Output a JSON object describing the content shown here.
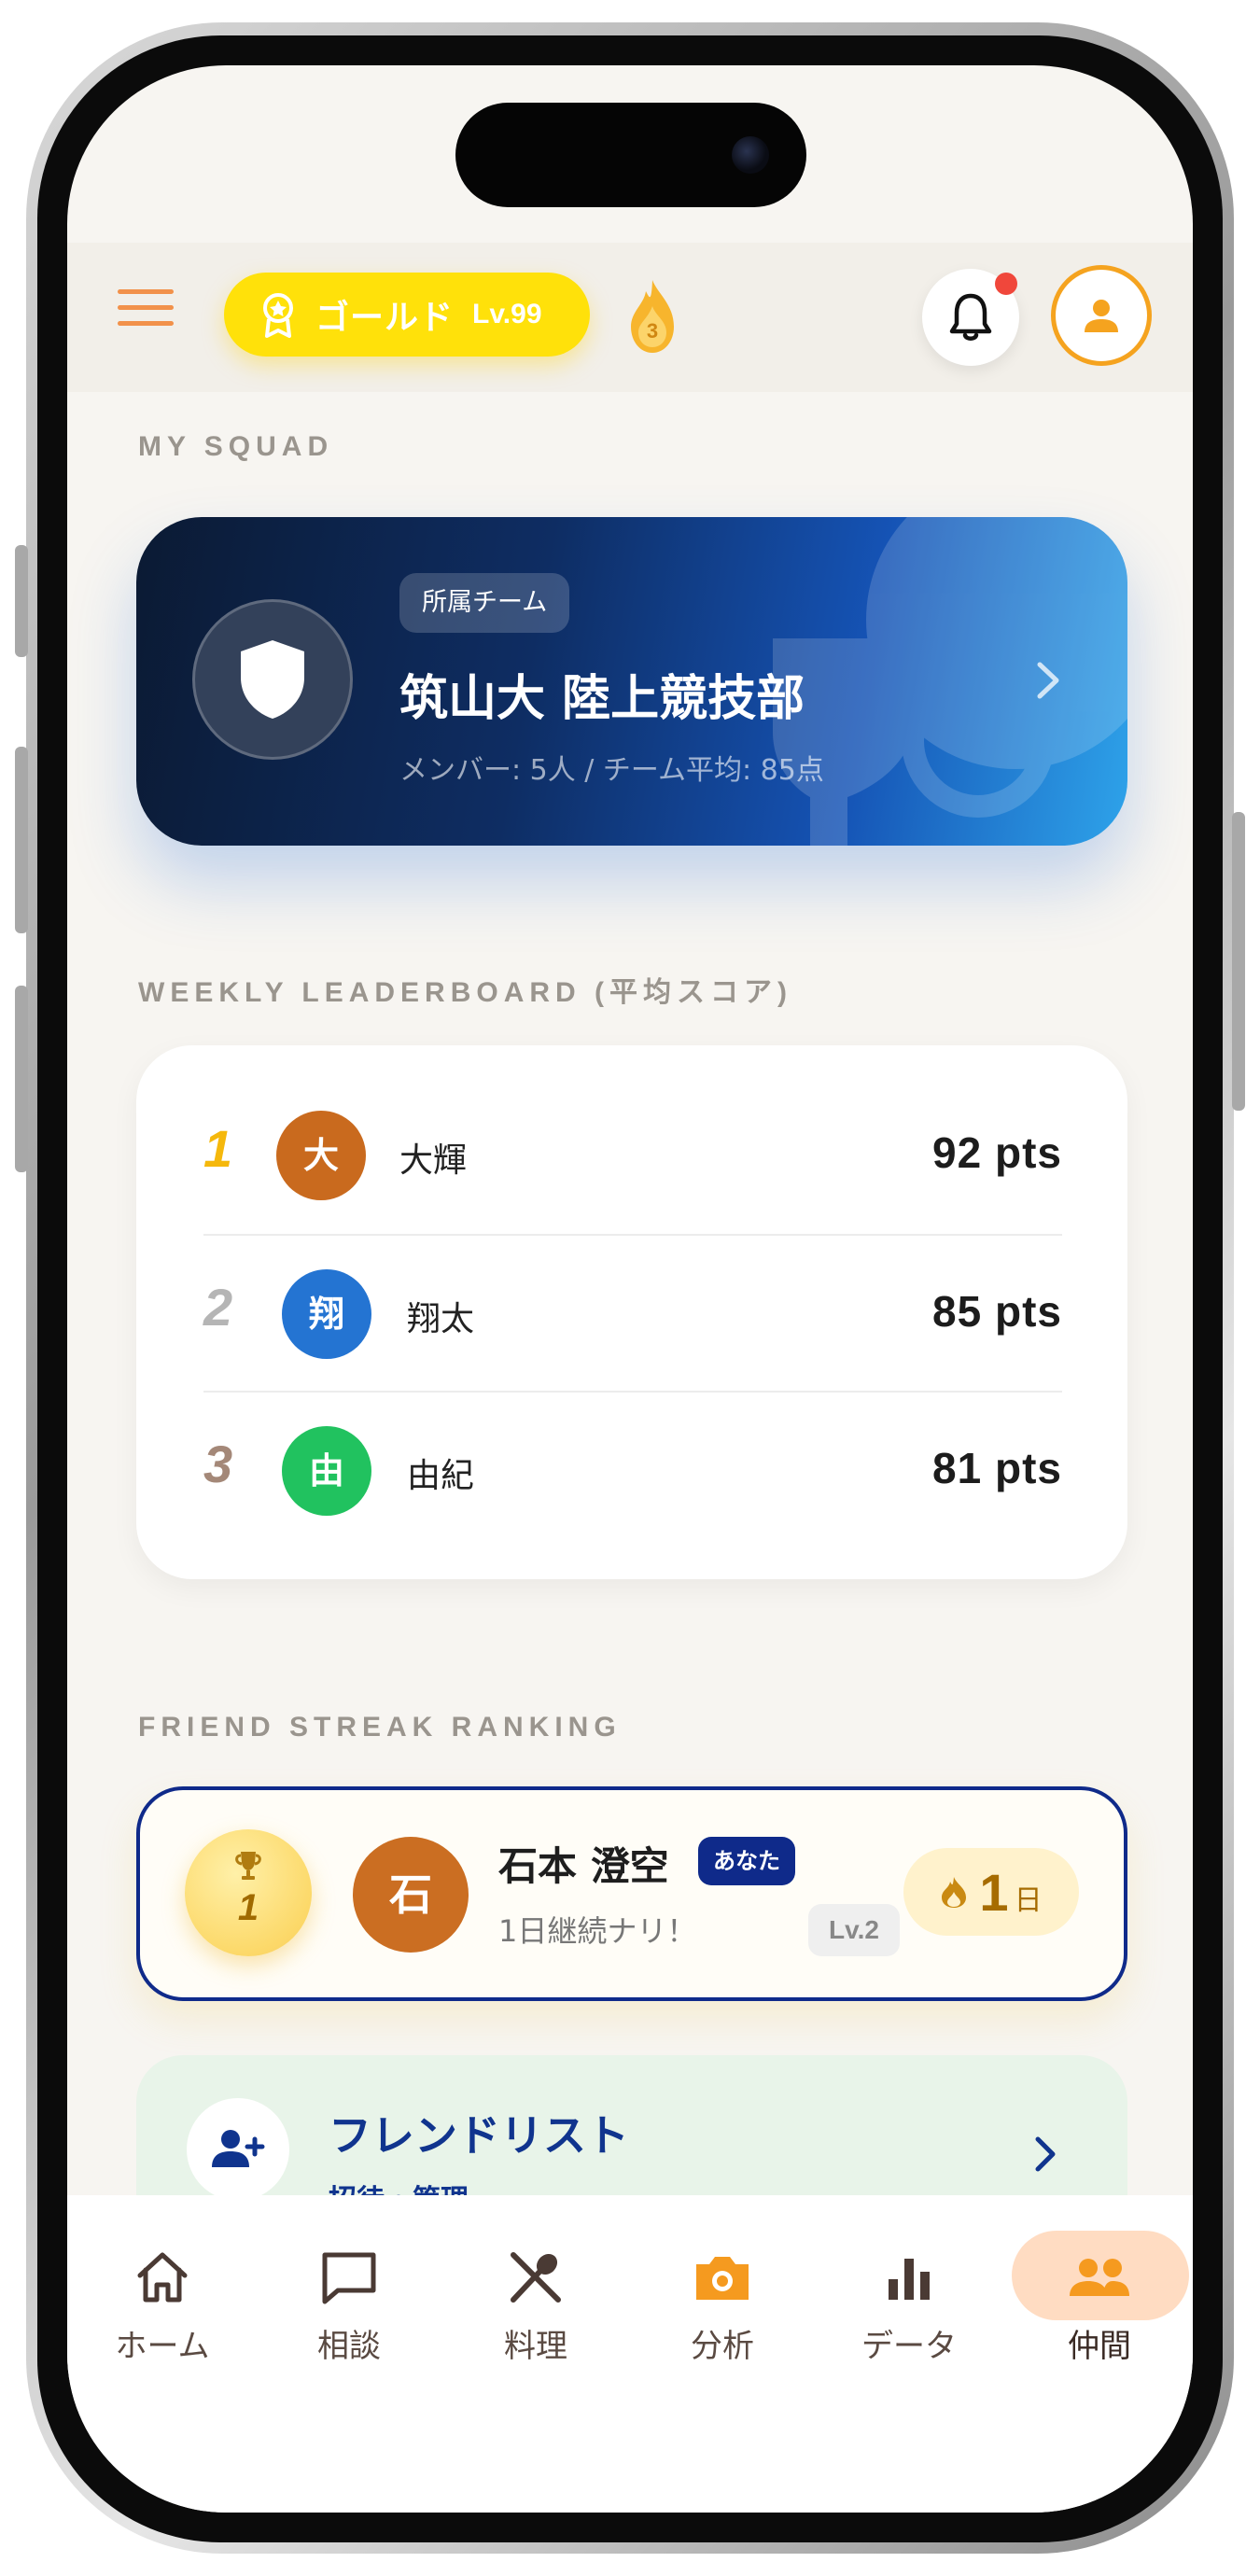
{
  "header": {
    "rank_name": "ゴールド",
    "rank_level": "Lv.99",
    "streak_count": "3",
    "accent_color": "#f5a31f"
  },
  "squad": {
    "section_label": "MY SQUAD",
    "tag": "所属チーム",
    "team_name": "筑山大 陸上競技部",
    "meta": "メンバー: 5人 / チーム平均: 85点"
  },
  "leaderboard": {
    "section_label": "WEEKLY LEADERBOARD (平均スコア)",
    "rows": [
      {
        "rank": "1",
        "initial": "大",
        "name": "大輝",
        "score": "92 pts"
      },
      {
        "rank": "2",
        "initial": "翔",
        "name": "翔太",
        "score": "85 pts"
      },
      {
        "rank": "3",
        "initial": "由",
        "name": "由紀",
        "score": "81 pts"
      }
    ]
  },
  "streak": {
    "section_label": "FRIEND STREAK RANKING",
    "rank": "1",
    "initial": "石",
    "name": "石本 澄空",
    "tag": "あなた",
    "subtitle": "1日継続ナリ！",
    "level": "Lv.2",
    "days": "1",
    "unit": "日"
  },
  "friends": {
    "title": "フレンドリスト",
    "subtitle": "招待・管理"
  },
  "nav": {
    "items": [
      {
        "label": "ホーム",
        "icon": "home-icon"
      },
      {
        "label": "相談",
        "icon": "chat-icon"
      },
      {
        "label": "料理",
        "icon": "utensils-icon"
      },
      {
        "label": "分析",
        "icon": "camera-icon"
      },
      {
        "label": "データ",
        "icon": "bar-chart-icon"
      },
      {
        "label": "仲間",
        "icon": "people-icon"
      }
    ],
    "active": "仲間"
  }
}
